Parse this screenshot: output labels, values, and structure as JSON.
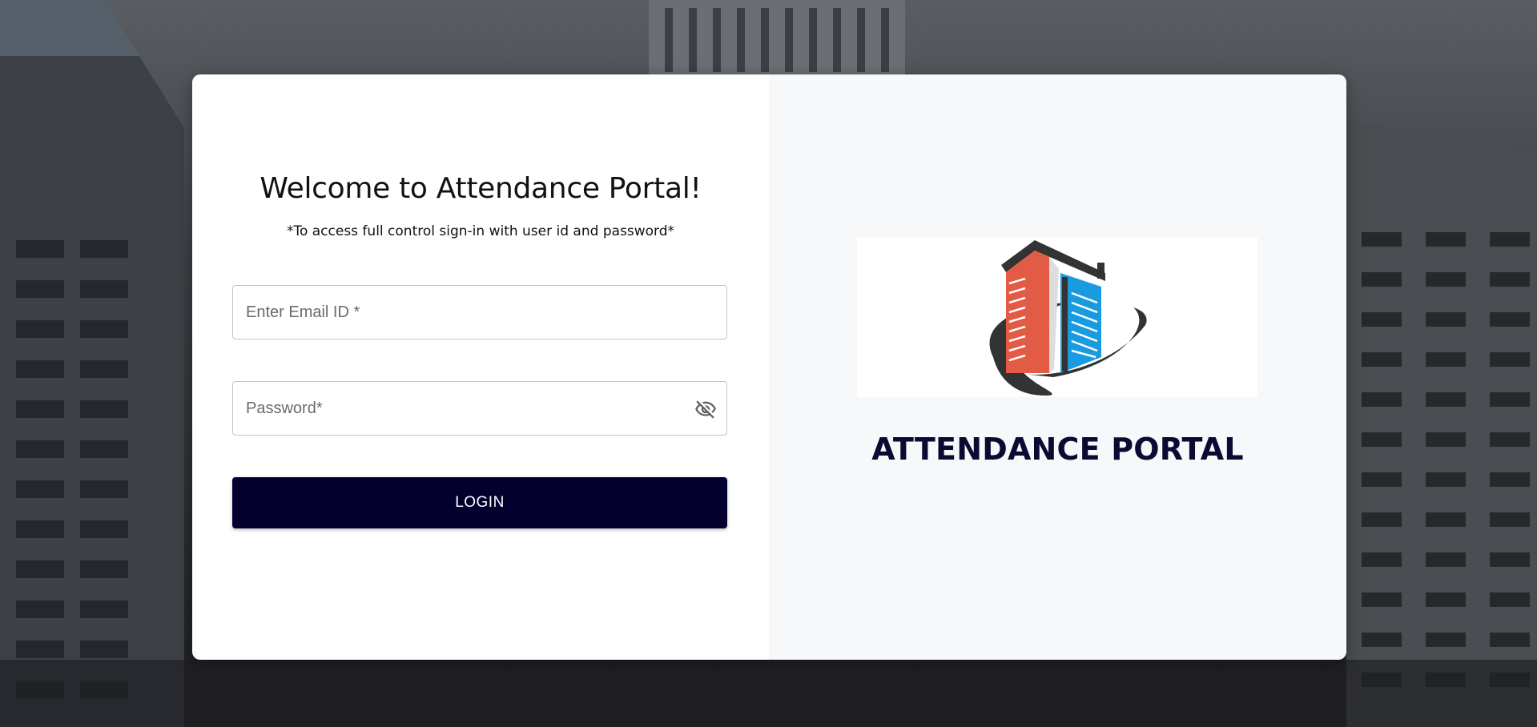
{
  "login_panel": {
    "title": "Welcome to Attendance Portal!",
    "subtitle": "*To access full control sign-in with user id and password*",
    "email": {
      "value": "",
      "placeholder": "Enter Email ID *"
    },
    "password": {
      "value": "",
      "placeholder": "Password*",
      "toggle_icon": "eye-off-icon"
    },
    "login_button_label": "LOGIN"
  },
  "brand_panel": {
    "logo_icon": "building-logo-icon",
    "brand_name": "ATTENDANCE PORTAL"
  },
  "colors": {
    "primary": "#04002e",
    "brand_text": "#0b0a33",
    "logo_red": "#e25b45",
    "logo_blue": "#1a9be0",
    "logo_dark": "#333333"
  }
}
